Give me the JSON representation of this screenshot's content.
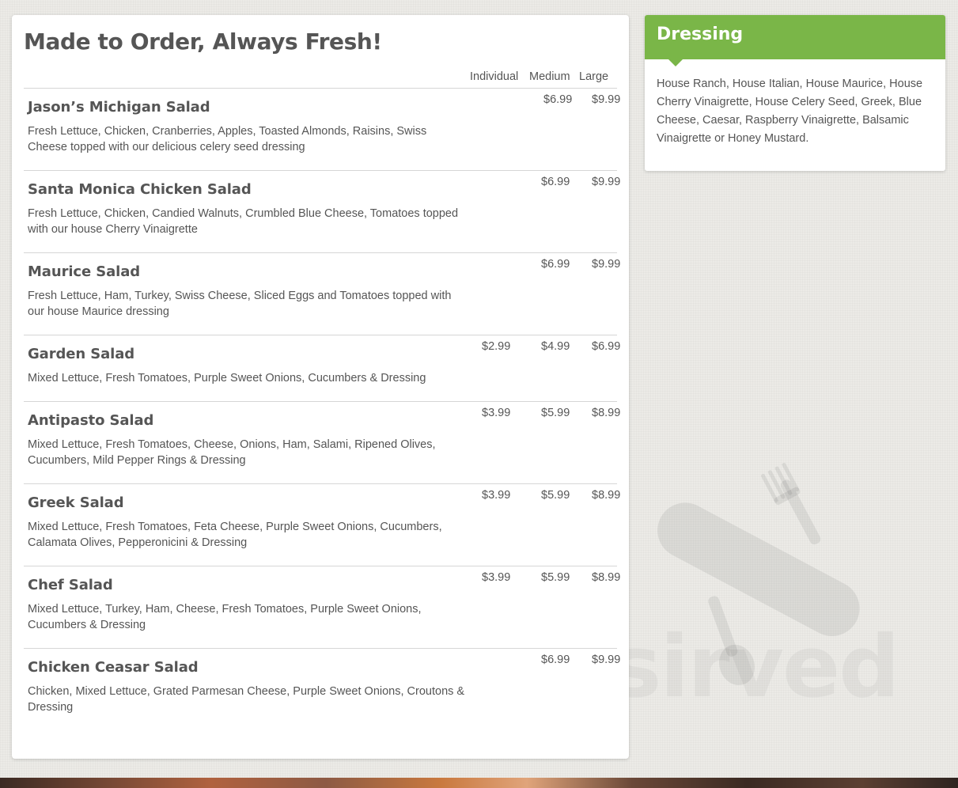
{
  "menu": {
    "title": "Made to Order, Always Fresh!",
    "columns": {
      "individual": "Individual",
      "medium": "Medium",
      "large": "Large"
    },
    "items": [
      {
        "name": "Jason’s Michigan Salad",
        "description": "Fresh Lettuce, Chicken, Cranberries, Apples, Toasted Almonds, Raisins, Swiss Cheese topped with our delicious celery seed dressing",
        "individual": "",
        "medium": "$6.99",
        "large": "$9.99"
      },
      {
        "name": "Santa Monica Chicken Salad",
        "description": "Fresh Lettuce, Chicken, Candied Walnuts, Crumbled Blue Cheese, Tomatoes topped with our house Cherry Vinaigrette",
        "individual": "",
        "medium": "$6.99",
        "large": "$9.99"
      },
      {
        "name": "Maurice Salad",
        "description": "Fresh Lettuce, Ham, Turkey, Swiss Cheese, Sliced Eggs and Tomatoes topped with our house Maurice dressing",
        "individual": "",
        "medium": "$6.99",
        "large": "$9.99"
      },
      {
        "name": "Garden Salad",
        "description": "Mixed Lettuce, Fresh Tomatoes, Purple Sweet Onions, Cucumbers & Dressing",
        "individual": "$2.99",
        "medium": "$4.99",
        "large": "$6.99"
      },
      {
        "name": "Antipasto Salad",
        "description": "Mixed Lettuce, Fresh Tomatoes, Cheese, Onions, Ham, Salami, Ripened Olives, Cucumbers, Mild Pepper Rings & Dressing",
        "individual": "$3.99",
        "medium": "$5.99",
        "large": "$8.99"
      },
      {
        "name": "Greek Salad",
        "description": "Mixed Lettuce, Fresh Tomatoes, Feta Cheese, Purple Sweet Onions, Cucumbers, Calamata Olives, Pepperonicini & Dressing",
        "individual": "$3.99",
        "medium": "$5.99",
        "large": "$8.99"
      },
      {
        "name": "Chef Salad",
        "description": "Mixed Lettuce, Turkey, Ham, Cheese, Fresh Tomatoes, Purple Sweet Onions, Cucumbers & Dressing",
        "individual": "$3.99",
        "medium": "$5.99",
        "large": "$8.99"
      },
      {
        "name": "Chicken Ceasar Salad",
        "description": "Chicken, Mixed Lettuce, Grated Parmesan Cheese, Purple Sweet Onions, Croutons & Dressing",
        "individual": "",
        "medium": "$6.99",
        "large": "$9.99"
      }
    ]
  },
  "dressing": {
    "title": "Dressing",
    "text": "House Ranch, House Italian, House Maurice, House Cherry Vinaigrette, House Celery Seed, Greek, Blue Cheese, Caesar, Raspberry Vinaigrette, Balsamic Vinaigrette or Honey Mustard."
  },
  "watermark": {
    "word": "sirved",
    "icon": "pocket-knife-fork-spoon-icon"
  },
  "colors": {
    "accent": "#7ab648",
    "text": "#555555",
    "rule": "#d6d6d6"
  }
}
